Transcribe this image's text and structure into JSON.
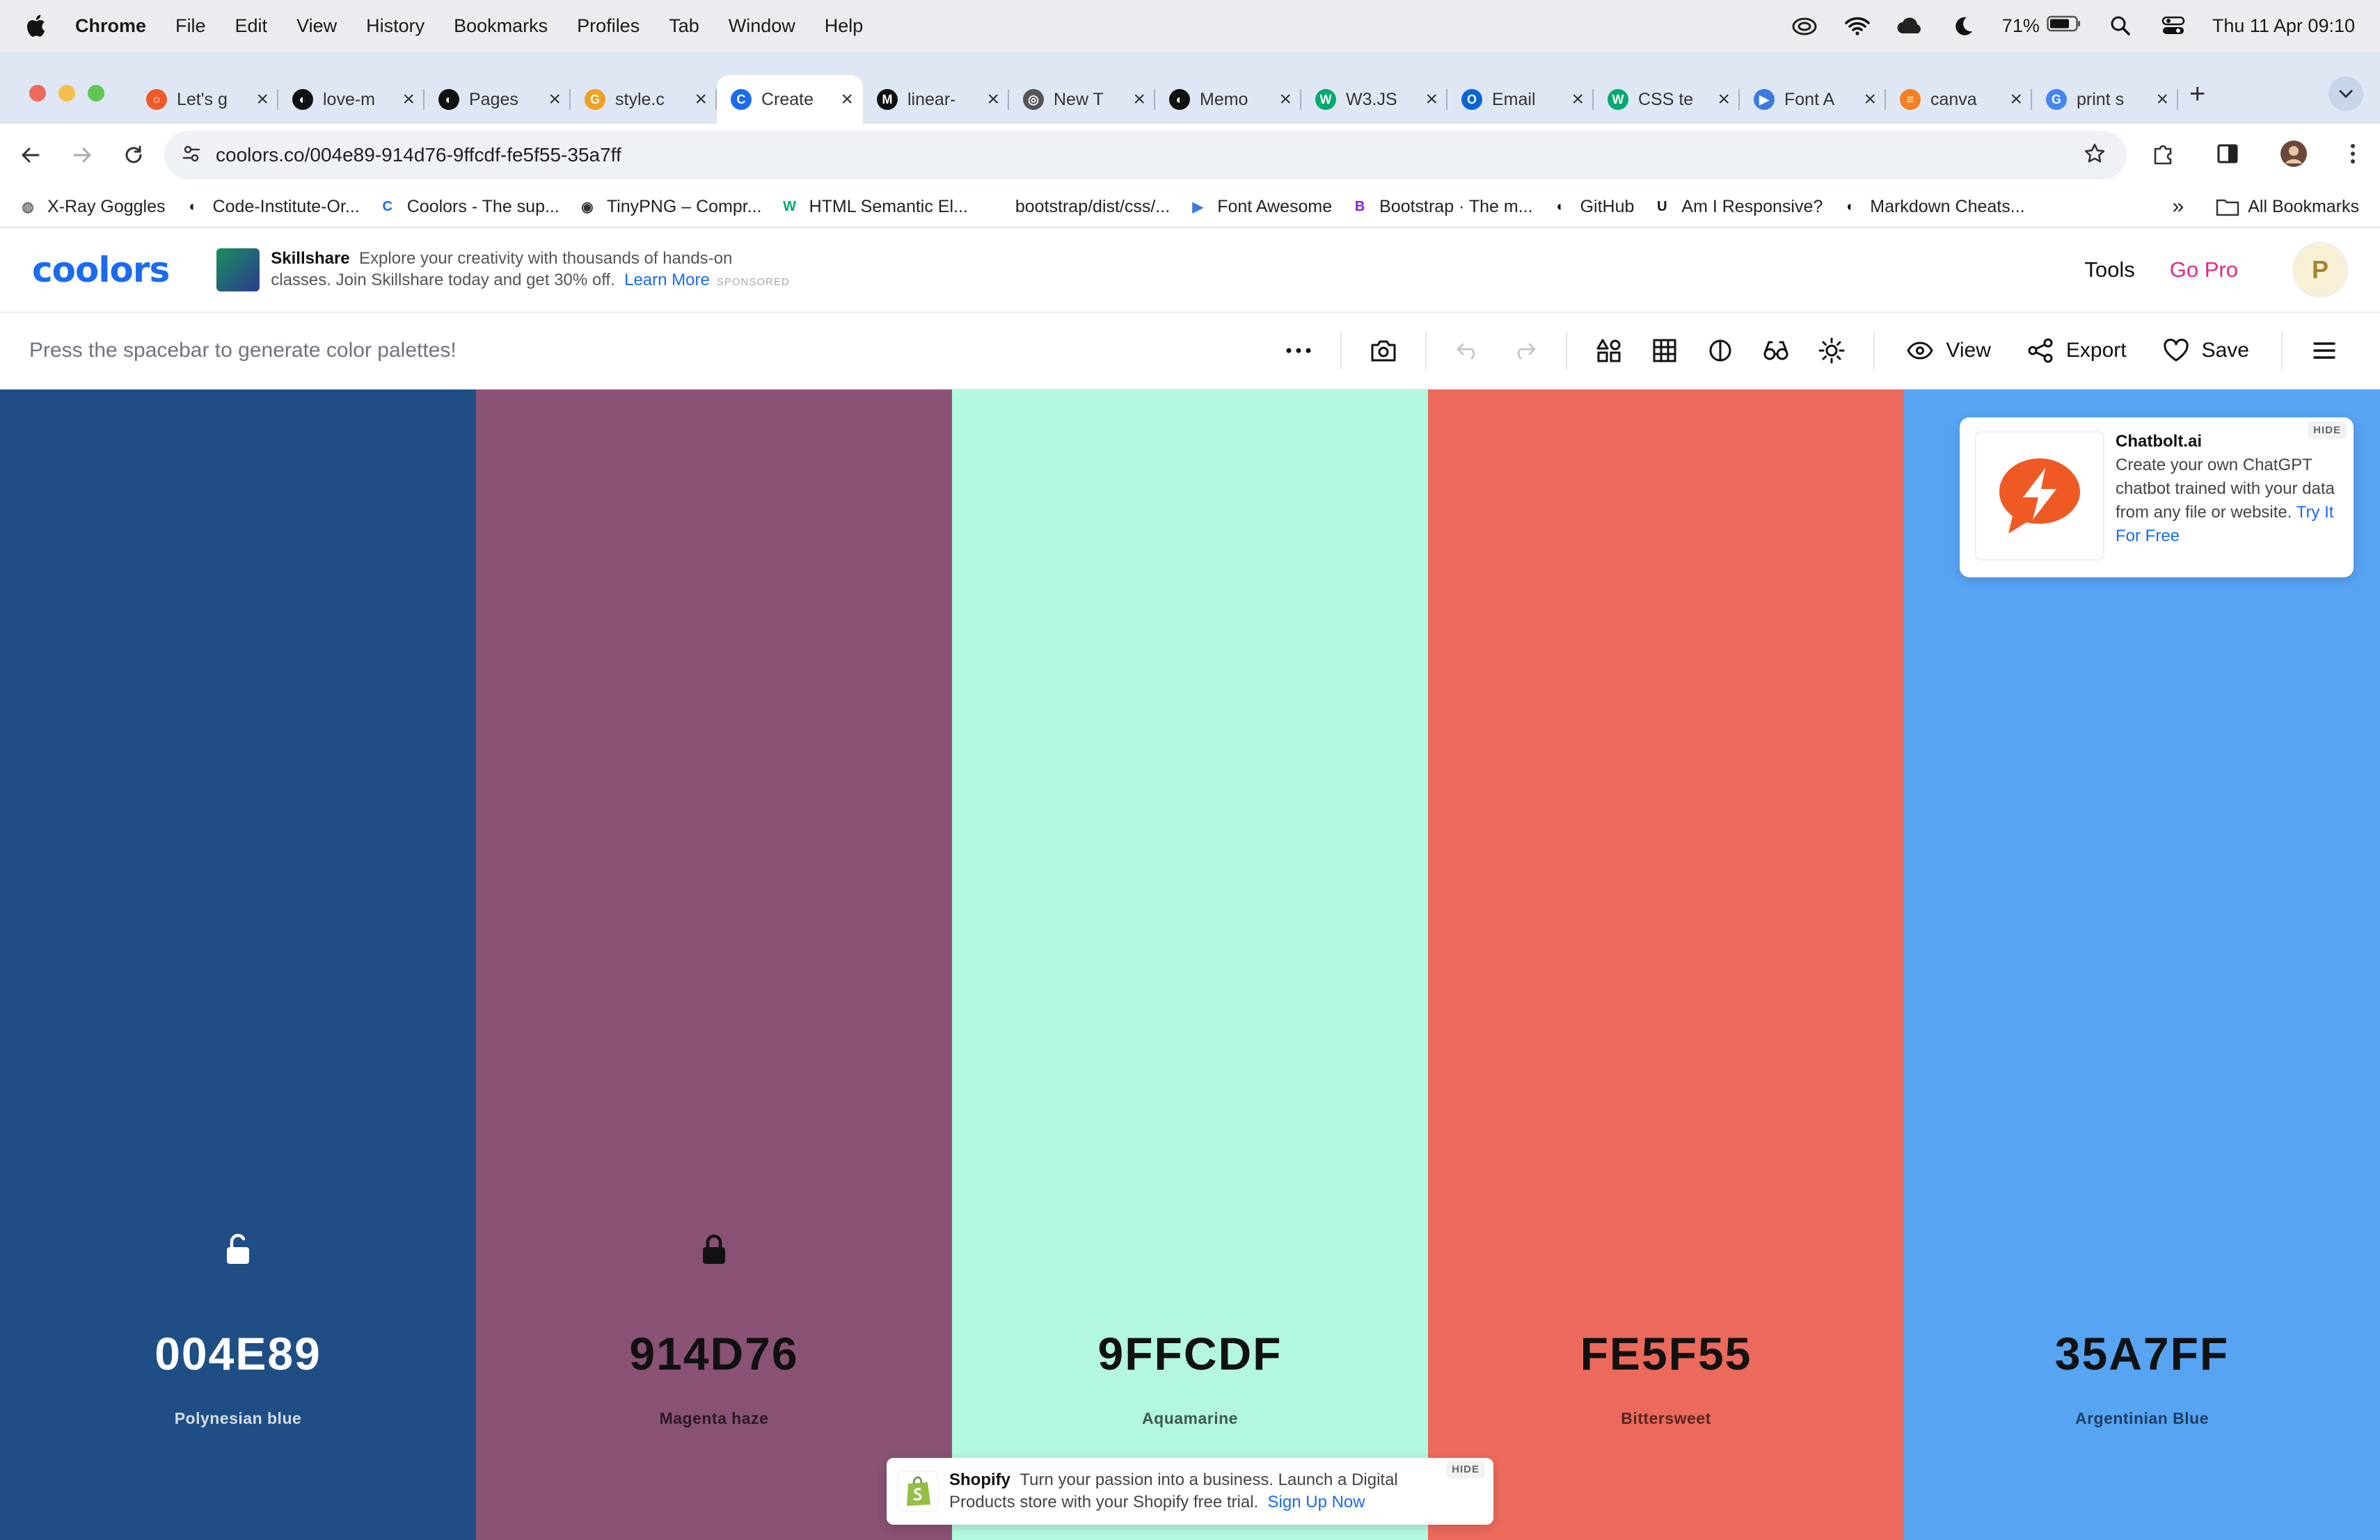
{
  "menubar": {
    "app": "Chrome",
    "items": [
      "File",
      "Edit",
      "View",
      "History",
      "Bookmarks",
      "Profiles",
      "Tab",
      "Window",
      "Help"
    ],
    "battery": "71%",
    "clock": "Thu 11 Apr  09:10"
  },
  "tabs": [
    {
      "title": "Let's g",
      "favicon": "circle-icon",
      "color": "#f05a28"
    },
    {
      "title": "love-m",
      "favicon": "github-icon",
      "color": "#111111"
    },
    {
      "title": "Pages",
      "favicon": "github-icon",
      "color": "#111111"
    },
    {
      "title": "style.c",
      "favicon": "g-icon",
      "color": "#f0a020"
    },
    {
      "title": "Create",
      "favicon": "coolors-icon",
      "color": "#1a6bf0",
      "active": true
    },
    {
      "title": "linear-",
      "favicon": "m-icon",
      "color": "#111111"
    },
    {
      "title": "New T",
      "favicon": "chrome-icon",
      "color": "#555555"
    },
    {
      "title": "Memo",
      "favicon": "github-icon",
      "color": "#111111"
    },
    {
      "title": "W3.JS",
      "favicon": "w3-icon",
      "color": "#04aa6d"
    },
    {
      "title": "Email",
      "favicon": "outlook-icon",
      "color": "#0a64d6"
    },
    {
      "title": "CSS te",
      "favicon": "w3-icon",
      "color": "#04aa6d"
    },
    {
      "title": "Font A",
      "favicon": "flag-icon",
      "color": "#3b7be0"
    },
    {
      "title": "canva",
      "favicon": "stack-icon",
      "color": "#f48024"
    },
    {
      "title": "print s",
      "favicon": "google-icon",
      "color": "#4285f4"
    }
  ],
  "address": {
    "url": "coolors.co/004e89-914d76-9ffcdf-fe5f55-35a7ff"
  },
  "bookmarks": [
    {
      "label": "X-Ray Goggles",
      "icon": "globe-icon"
    },
    {
      "label": "Code-Institute-Or...",
      "icon": "github-icon"
    },
    {
      "label": "Coolors - The sup...",
      "icon": "coolors-icon"
    },
    {
      "label": "TinyPNG – Compr...",
      "icon": "panda-icon"
    },
    {
      "label": "HTML Semantic El...",
      "icon": "w3-icon"
    },
    {
      "label": "bootstrap/dist/css/...",
      "icon": "blank-icon"
    },
    {
      "label": "Font Awesome",
      "icon": "flag-icon"
    },
    {
      "label": "Bootstrap · The m...",
      "icon": "bootstrap-icon"
    },
    {
      "label": "GitHub",
      "icon": "github-icon"
    },
    {
      "label": "Am I Responsive?",
      "icon": "ui-icon"
    },
    {
      "label": "Markdown Cheats...",
      "icon": "github-icon"
    }
  ],
  "bookmarks_more": "»",
  "all_bookmarks": "All Bookmarks",
  "header": {
    "logo": "coolors",
    "ad": {
      "brand": "Skillshare",
      "text1": "Explore your creativity with thousands of hands-on",
      "text2": "classes. Join Skillshare today and get 30% off.",
      "link": "Learn More",
      "sponsored": "SPONSORED"
    },
    "tools": "Tools",
    "gopro": "Go Pro",
    "avatar": "P"
  },
  "generator": {
    "hint": "Press the spacebar to generate color palettes!",
    "view": "View",
    "export": "Export",
    "save": "Save"
  },
  "palette": [
    {
      "hex": "004E89",
      "name": "Polynesian blue",
      "color": "#1f4e85",
      "text": "#ffffff",
      "subtext": "#d5dde8",
      "lock": "unlocked",
      "lock_color": "#ffffff"
    },
    {
      "hex": "914D76",
      "name": "Magenta haze",
      "color": "#8a5274",
      "text": "#111111",
      "subtext": "#2a1a24",
      "lock": "locked",
      "lock_color": "#111111"
    },
    {
      "hex": "9FFCDF",
      "name": "Aquamarine",
      "color": "#b3f7df",
      "text": "#111111",
      "subtext": "#3f5a50",
      "lock": "none"
    },
    {
      "hex": "FE5F55",
      "name": "Bittersweet",
      "color": "#eb6a5c",
      "text": "#111111",
      "subtext": "#5a2620",
      "lock": "none"
    },
    {
      "hex": "35A7FF",
      "name": "Argentinian Blue",
      "color": "#57a4f3",
      "text": "#111111",
      "subtext": "#1d3f63",
      "lock": "none"
    }
  ],
  "chatbolt": {
    "brand": "Chatbolt.ai",
    "text": "Create your own ChatGPT chatbot trained with your data from any file or website.",
    "link": "Try It For Free",
    "hide": "HIDE"
  },
  "shopify": {
    "brand": "Shopify",
    "text1": "Turn your passion into a business. Launch a Digital",
    "text2": "Products store with your Shopify free trial.",
    "link": "Sign Up Now",
    "hide": "HIDE"
  }
}
